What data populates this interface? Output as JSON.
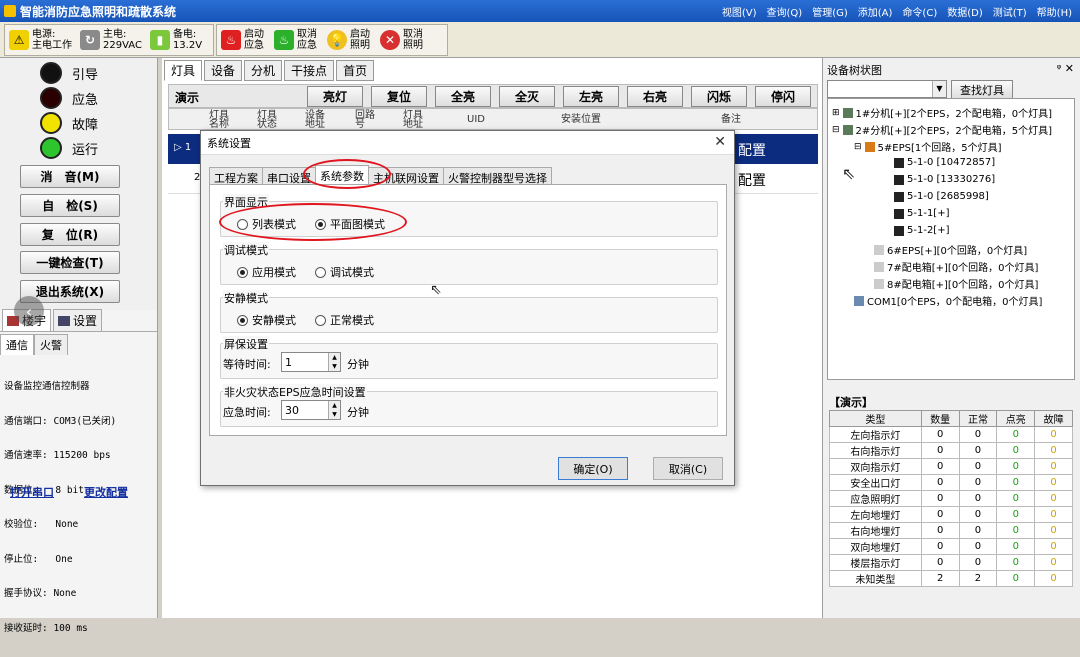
{
  "app": {
    "title": "智能消防应急照明和疏散系统"
  },
  "menu": [
    "视图(V)",
    "查询(Q)",
    "管理(G)",
    "添加(A)",
    "命令(C)",
    "数据(D)",
    "测试(T)",
    "帮助(H)"
  ],
  "toolbar": {
    "power_label": "电源:",
    "power_value": "主电工作",
    "main_label": "主电:",
    "main_value": "229VAC",
    "backup_label": "备电:",
    "backup_value": "13.2V",
    "btn1": "启动应急",
    "btn2": "取消应急",
    "btn3": "启动照明",
    "btn4": "取消照明"
  },
  "left": {
    "lamps": [
      {
        "label": "引导",
        "color": "#111111"
      },
      {
        "label": "应急",
        "color": "#2a0000"
      },
      {
        "label": "故障",
        "color": "#f2e200"
      },
      {
        "label": "运行",
        "color": "#2ec42e"
      }
    ],
    "buttons": [
      "消　音(M)",
      "自　检(S)",
      "复　位(R)",
      "一键检查(T)",
      "退出系统(X)"
    ],
    "tabs": [
      "楼宇",
      "设置"
    ],
    "subtabs": [
      "通信",
      "火警"
    ],
    "comm_lines": [
      "设备监控通信控制器",
      "通信端口: COM3(已关闭)",
      "通信速率: 115200 bps",
      "数据位:   8 bit",
      "校验位:   None",
      "停止位:   One",
      "握手协议: None",
      "接收延时: 100 ms"
    ],
    "link_open": "打开串口",
    "link_change": "更改配置"
  },
  "main": {
    "tabs": [
      "灯具",
      "设备",
      "分机",
      "干接点",
      "首页"
    ],
    "demo_label": "演示",
    "demo_buttons": [
      "亮灯",
      "复位",
      "全亮",
      "全灭",
      "左亮",
      "右亮",
      "闪烁",
      "停闪"
    ],
    "headers": [
      "灯具名称",
      "灯具状态",
      "设备地址",
      "回路号",
      "灯具地址",
      "UID",
      "安装位置",
      "备注"
    ],
    "row1_marker": "▷ 1",
    "row1_note": "配置",
    "row2_marker": "2",
    "row2_note": "配置"
  },
  "dialog": {
    "title": "系统设置",
    "tabs": [
      "工程方案",
      "串口设置",
      "系统参数",
      "主机联网设置",
      "火警控制器型号选择"
    ],
    "group1": {
      "label": "界面显示",
      "opt1": "列表模式",
      "opt2": "平面图模式"
    },
    "group2": {
      "label": "调试模式",
      "opt1": "应用模式",
      "opt2": "调试模式"
    },
    "group3": {
      "label": "安静模式",
      "opt1": "安静模式",
      "opt2": "正常模式"
    },
    "group4": {
      "label": "屏保设置",
      "field": "等待时间:",
      "value": "1",
      "unit": "分钟"
    },
    "group5": {
      "label": "非火灾状态EPS应急时间设置",
      "field": "应急时间:",
      "value": "30",
      "unit": "分钟"
    },
    "ok": "确定(O)",
    "cancel": "取消(C)"
  },
  "right": {
    "title": "设备树状图",
    "pin": "ᵠ ✕",
    "search_btn": "查找灯具",
    "tree": [
      "1#分机[+][2个EPS，2个配电箱，0个灯具]",
      "2#分机[+][2个EPS，2个配电箱，5个灯具]",
      "5#EPS[1个回路，5个灯具]",
      "5-1-0 [10472857]",
      "5-1-0 [13330276]",
      "5-1-0 [2685998]",
      "5-1-1[+]",
      "5-1-2[+]",
      "6#EPS[+][0个回路，0个灯具]",
      "7#配电箱[+][0个回路，0个灯具]",
      "8#配电箱[+][0个回路，0个灯具]",
      "COM1[0个EPS，0个配电箱，0个灯具]"
    ],
    "demo_title": "【演示】",
    "table_headers": [
      "类型",
      "数量",
      "正常",
      "点亮",
      "故障"
    ],
    "table_rows": [
      [
        "左向指示灯",
        "0",
        "0",
        "0",
        "0"
      ],
      [
        "右向指示灯",
        "0",
        "0",
        "0",
        "0"
      ],
      [
        "双向指示灯",
        "0",
        "0",
        "0",
        "0"
      ],
      [
        "安全出口灯",
        "0",
        "0",
        "0",
        "0"
      ],
      [
        "应急照明灯",
        "0",
        "0",
        "0",
        "0"
      ],
      [
        "左向地埋灯",
        "0",
        "0",
        "0",
        "0"
      ],
      [
        "右向地埋灯",
        "0",
        "0",
        "0",
        "0"
      ],
      [
        "双向地埋灯",
        "0",
        "0",
        "0",
        "0"
      ],
      [
        "楼层指示灯",
        "0",
        "0",
        "0",
        "0"
      ],
      [
        "未知类型",
        "2",
        "2",
        "0",
        "0"
      ]
    ]
  }
}
